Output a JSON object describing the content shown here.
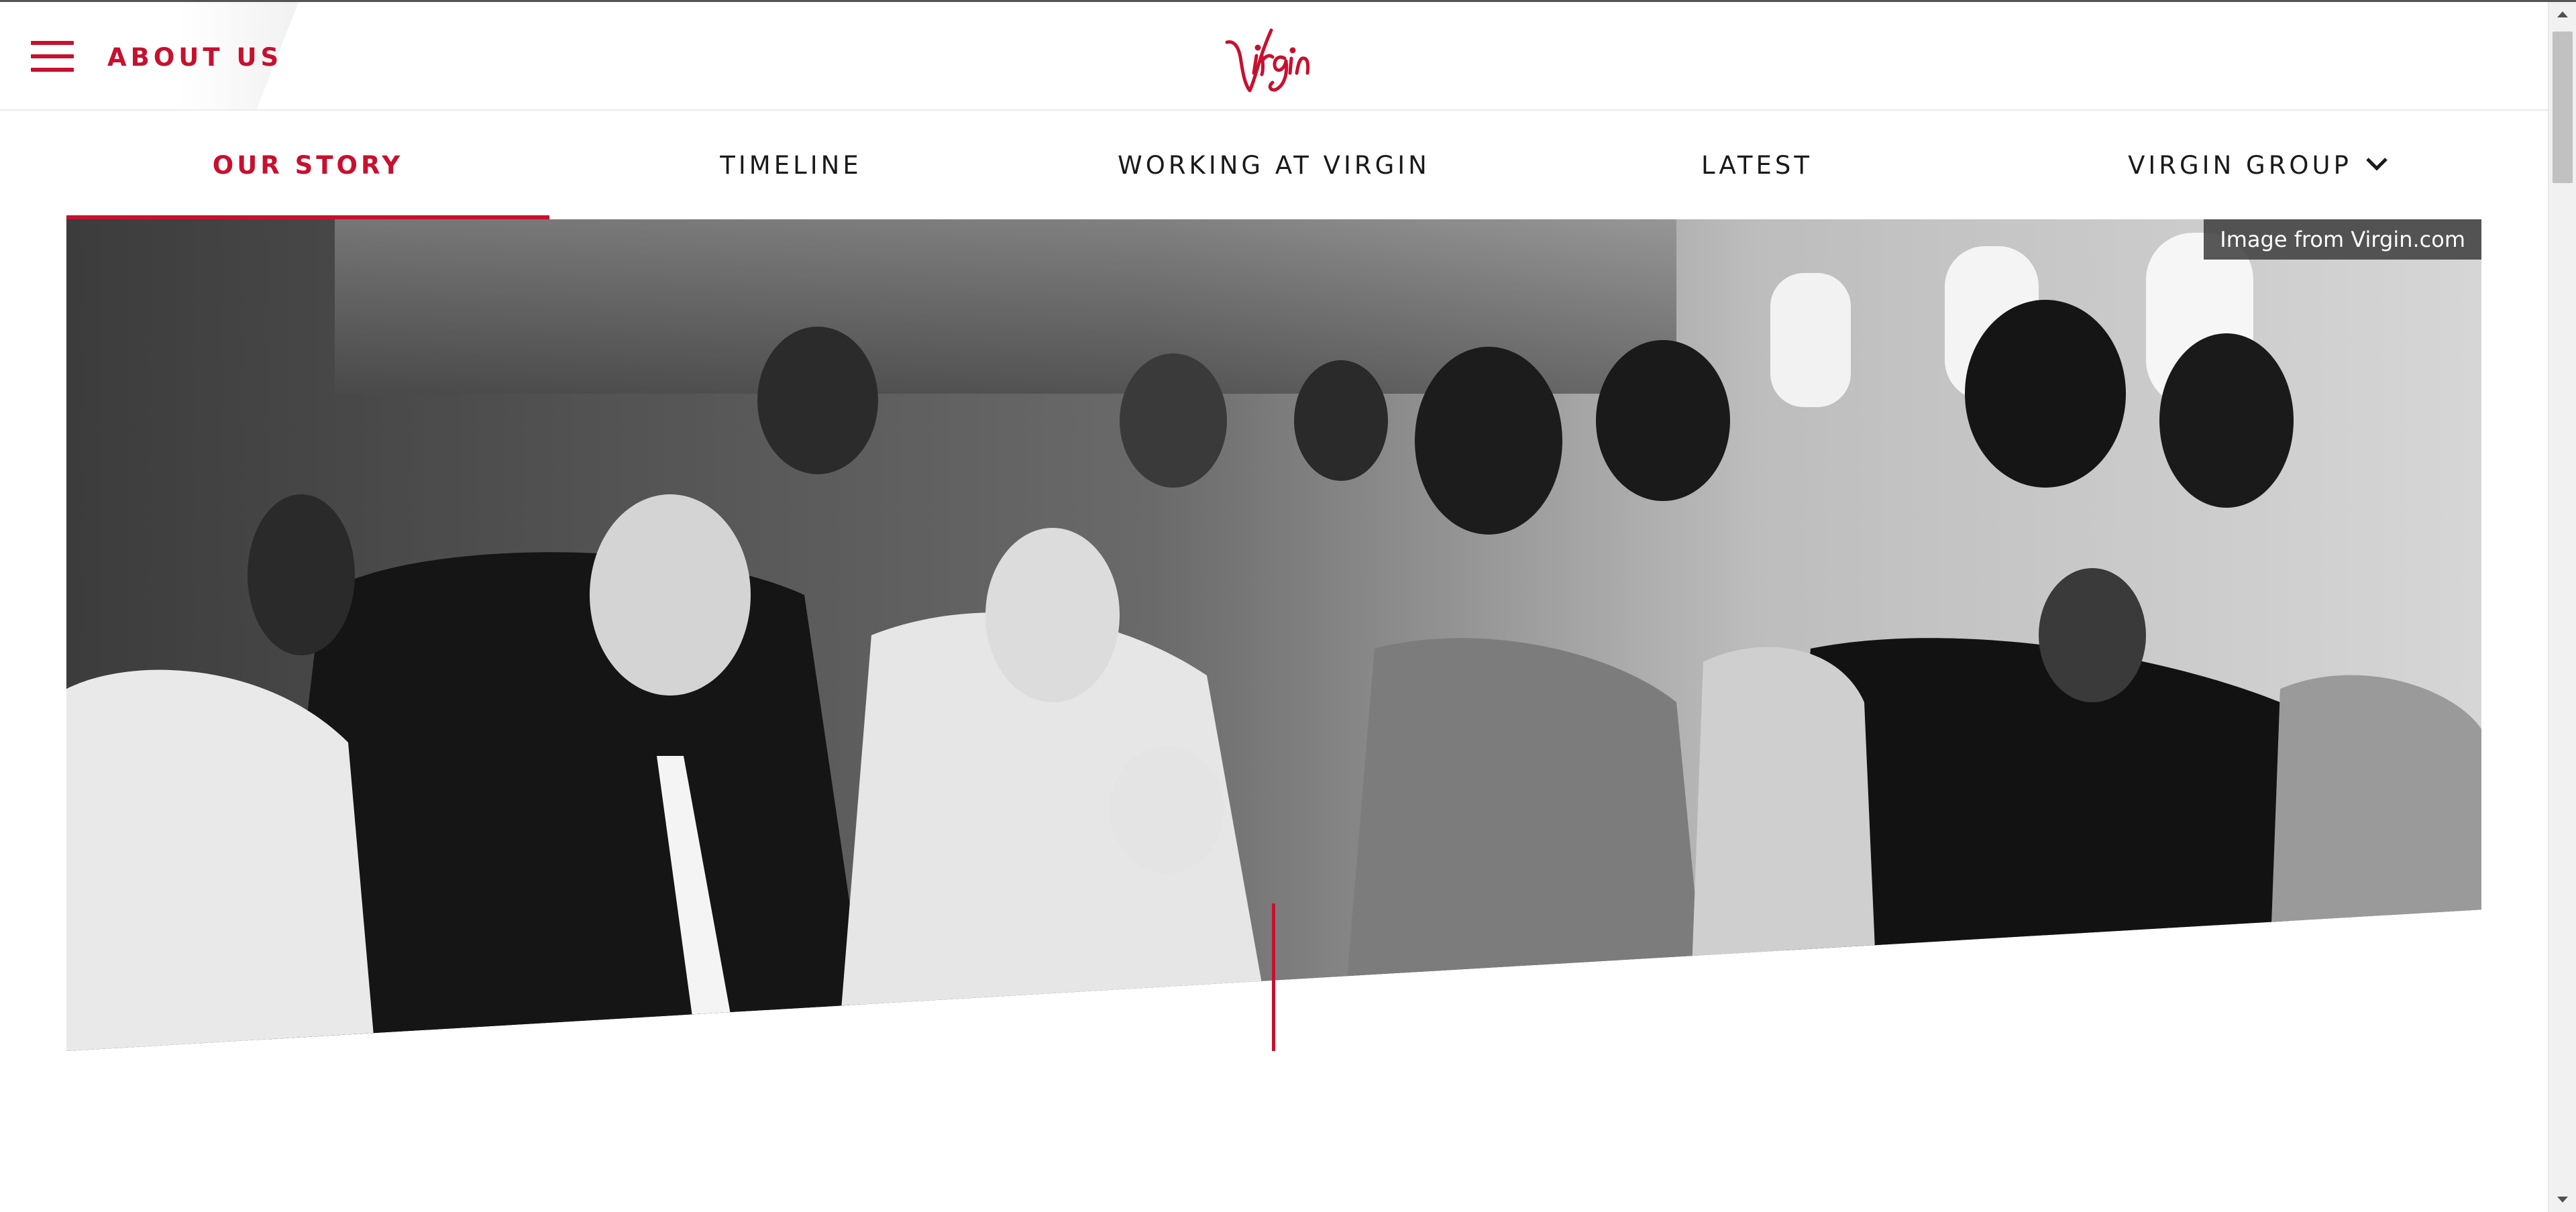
{
  "header": {
    "menu_icon": "hamburger-icon",
    "section_label": "ABOUT US",
    "logo_text": "Virgin",
    "brand_color": "#c8102e"
  },
  "subnav": {
    "items": [
      {
        "label": "OUR STORY",
        "active": true
      },
      {
        "label": "TIMELINE",
        "active": false
      },
      {
        "label": "WORKING AT VIRGIN",
        "active": false
      },
      {
        "label": "LATEST",
        "active": false
      },
      {
        "label": "VIRGIN GROUP",
        "active": false
      }
    ],
    "dropdown_icon": "chevron-down-icon"
  },
  "hero": {
    "image_credit": "Image from Virgin.com",
    "image_style": "black-and-white photo"
  },
  "scrollbar": {
    "up_icon": "arrow-up-icon",
    "down_icon": "arrow-down-icon"
  }
}
